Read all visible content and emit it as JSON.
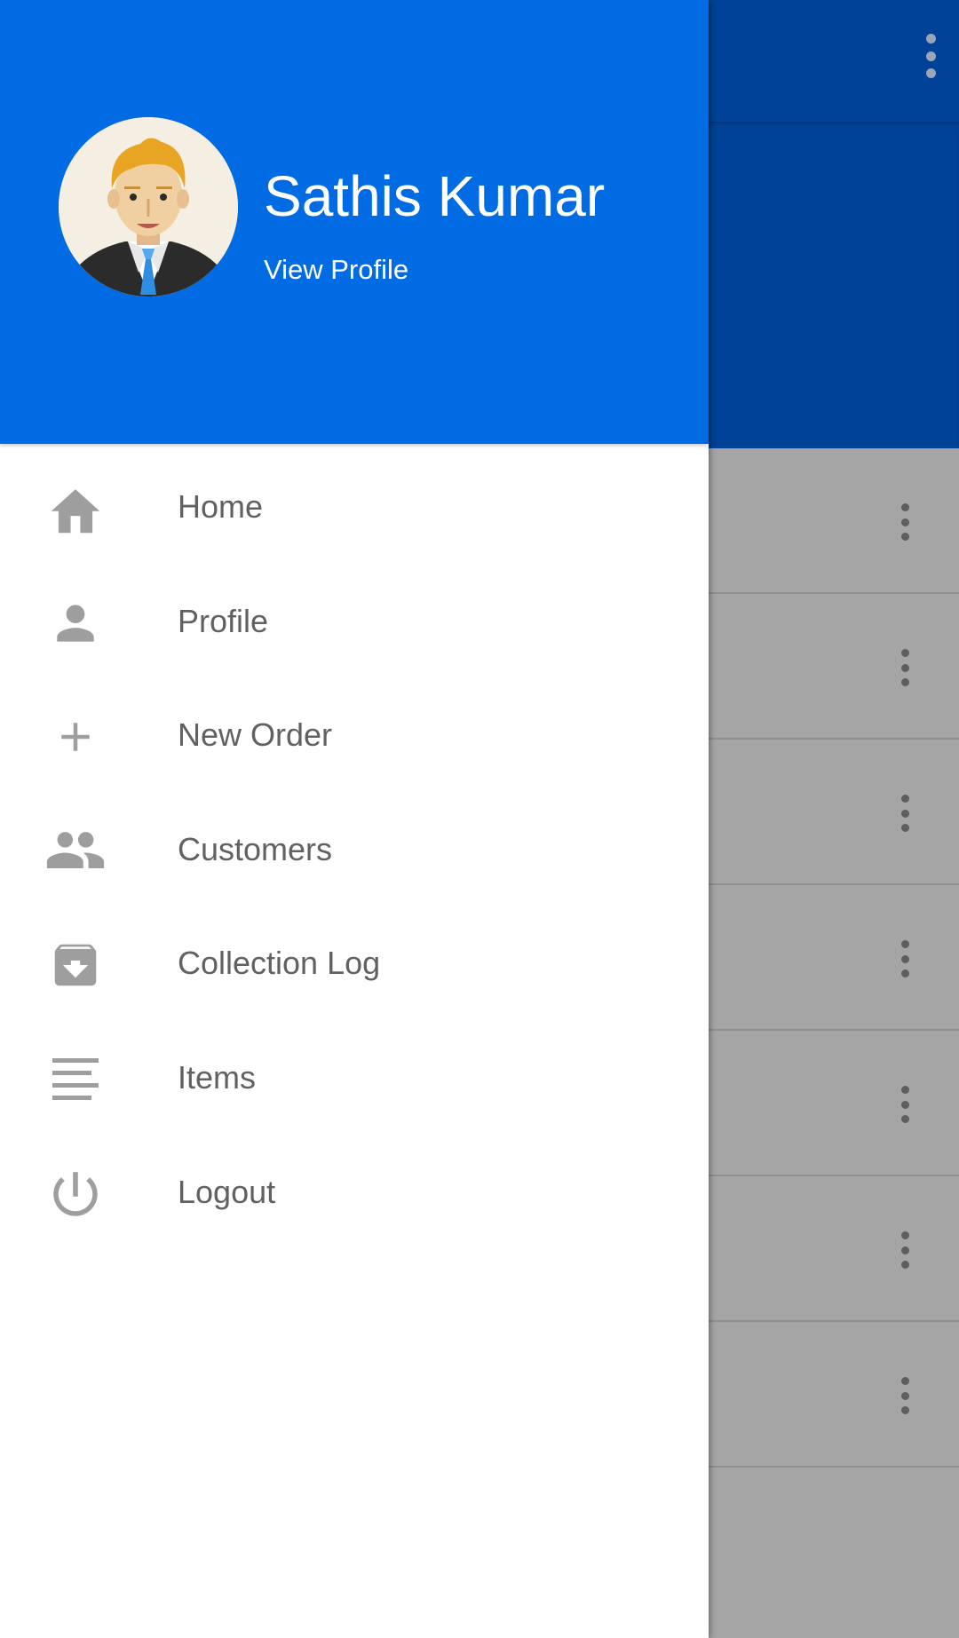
{
  "colors": {
    "drawer_header": "#006be3",
    "toolbar_dimmed": "#004297",
    "scrim": "#a5a5a5",
    "menu_text": "#616161",
    "menu_icon": "#9e9e9e"
  },
  "drawer": {
    "user_name": "Sathis Kumar",
    "view_profile": "View Profile",
    "avatar_icon": "businessman-avatar",
    "items": [
      {
        "label": "Home",
        "icon": "home-icon"
      },
      {
        "label": "Profile",
        "icon": "person-icon"
      },
      {
        "label": "New Order",
        "icon": "plus-icon"
      },
      {
        "label": "Customers",
        "icon": "group-icon"
      },
      {
        "label": "Collection Log",
        "icon": "archive-icon"
      },
      {
        "label": "Items",
        "icon": "list-lines-icon"
      },
      {
        "label": "Logout",
        "icon": "power-icon"
      }
    ]
  },
  "background": {
    "toolbar_menu_icon": "overflow-menu-icon",
    "row_menu_icon": "overflow-menu-icon",
    "row_count": 7
  }
}
